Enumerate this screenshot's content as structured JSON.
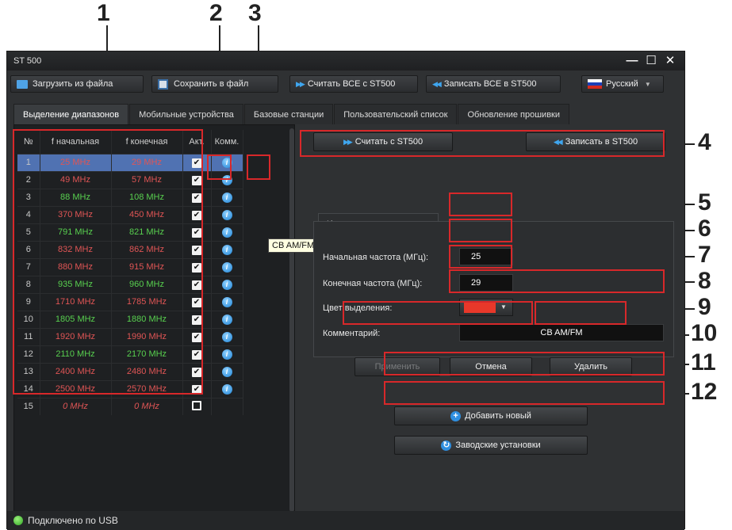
{
  "callouts": [
    "1",
    "2",
    "3",
    "4",
    "5",
    "6",
    "7",
    "8",
    "9",
    "10",
    "11",
    "12"
  ],
  "window": {
    "title": "ST 500",
    "minimize_glyph": "—",
    "maximize_glyph": "☐",
    "close_glyph": "✕"
  },
  "toolbar": {
    "load_label": "Загрузить из файла",
    "save_label": "Сохранить в файл",
    "read_all_label": "Считать ВСЕ с ST500",
    "write_all_label": "Записать ВСЕ в ST500",
    "language": "Русский"
  },
  "tabs": [
    {
      "label": "Выделение диапазонов",
      "active": true
    },
    {
      "label": "Мобильные устройства"
    },
    {
      "label": "Базовые станции"
    },
    {
      "label": "Пользовательский список"
    },
    {
      "label": "Обновление прошивки"
    }
  ],
  "table": {
    "headers": [
      "№",
      "f начальная",
      "f конечная",
      "Акт.",
      "Комм."
    ],
    "rows": [
      {
        "no": "1",
        "start": "25 MHz",
        "end": "29 MHz",
        "active": true,
        "comment": true,
        "color": "red",
        "selected": true
      },
      {
        "no": "2",
        "start": "49 MHz",
        "end": "57 MHz",
        "active": true,
        "comment": true,
        "color": "red"
      },
      {
        "no": "3",
        "start": "88 MHz",
        "end": "108 MHz",
        "active": true,
        "comment": true,
        "color": "green"
      },
      {
        "no": "4",
        "start": "370 MHz",
        "end": "450 MHz",
        "active": true,
        "comment": true,
        "color": "red"
      },
      {
        "no": "5",
        "start": "791 MHz",
        "end": "821 MHz",
        "active": true,
        "comment": true,
        "color": "green"
      },
      {
        "no": "6",
        "start": "832 MHz",
        "end": "862 MHz",
        "active": true,
        "comment": true,
        "color": "red"
      },
      {
        "no": "7",
        "start": "880 MHz",
        "end": "915 MHz",
        "active": true,
        "comment": true,
        "color": "red"
      },
      {
        "no": "8",
        "start": "935 MHz",
        "end": "960 MHz",
        "active": true,
        "comment": true,
        "color": "green"
      },
      {
        "no": "9",
        "start": "1710 MHz",
        "end": "1785 MHz",
        "active": true,
        "comment": true,
        "color": "red"
      },
      {
        "no": "10",
        "start": "1805 MHz",
        "end": "1880 MHz",
        "active": true,
        "comment": true,
        "color": "green"
      },
      {
        "no": "11",
        "start": "1920 MHz",
        "end": "1990 MHz",
        "active": true,
        "comment": true,
        "color": "red"
      },
      {
        "no": "12",
        "start": "2110 MHz",
        "end": "2170 MHz",
        "active": true,
        "comment": true,
        "color": "green"
      },
      {
        "no": "13",
        "start": "2400 MHz",
        "end": "2480 MHz",
        "active": true,
        "comment": true,
        "color": "red"
      },
      {
        "no": "14",
        "start": "2500 MHz",
        "end": "2570 MHz",
        "active": true,
        "comment": true,
        "color": "red"
      },
      {
        "no": "15",
        "start": "0 MHz",
        "end": "0 MHz",
        "active": false,
        "comment": false,
        "color": "ghost"
      }
    ]
  },
  "tooltip": "CB AM/FM",
  "right": {
    "read_label": "Считать с ST500",
    "write_label": "Записать в ST500",
    "group_title": "Изменение выделенного:",
    "start_label": "Начальная частота (МГц):",
    "start_value": "25",
    "end_label": "Конечная частота (МГц):",
    "end_value": "29",
    "color_label": "Цвет выделения:",
    "selected_color": "#e8382a",
    "comment_label": "Комментарий:",
    "comment_value": "CB AM/FM",
    "apply_label": "Применить",
    "cancel_label": "Отмена",
    "delete_label": "Удалить",
    "add_label": "Добавить новый",
    "factory_label": "Заводские установки"
  },
  "status": {
    "text": "Подключено по USB"
  }
}
